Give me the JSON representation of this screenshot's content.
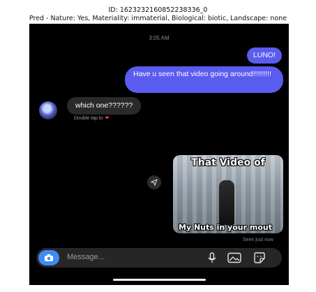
{
  "caption": {
    "id_line": "ID: 1623232160852238336_0",
    "pred_line": "Pred - Nature: Yes, Materiality: immaterial, Biological: biotic, Landscape: none"
  },
  "chat": {
    "time": "3:05 AM",
    "messages": [
      {
        "from": "me",
        "text": "LUNO!"
      },
      {
        "from": "me",
        "text": "Have u seen that video going around!!!!!!!!!"
      },
      {
        "from": "them",
        "text": "which one??????"
      }
    ],
    "double_tap": "Double tap to",
    "media": {
      "top_text": "That Video of",
      "bottom_text": "My Nuts in your mout"
    },
    "seen": "Seen just now"
  },
  "composer": {
    "placeholder": "Message..."
  },
  "icons": {
    "camera": "camera-icon",
    "mic": "microphone-icon",
    "gallery": "gallery-icon",
    "sticker": "sticker-icon",
    "share": "share-icon",
    "heart": "heart-icon"
  },
  "colors": {
    "sent_bubble": "#5a5cf0",
    "received_bubble": "#2a2a2c",
    "camera_button": "#3d8cf4",
    "heart": "#ef3b4a"
  }
}
